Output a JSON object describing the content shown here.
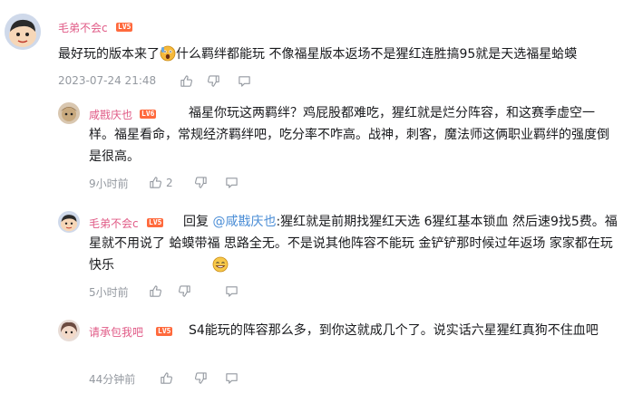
{
  "comments": [
    {
      "user": "毛弟不会c",
      "level": "LV5",
      "text": "最好玩的版本来了",
      "text_after_emoji": "什么羁绊都能玩 不像福星版本返场不是猩红连胜搞95就是天选福星蛤蟆",
      "time": "2023-07-24 21:48"
    },
    {
      "user": "咸戡庆也",
      "level": "LV6",
      "text": "福星你玩这两羁绊？鸡屁股都难吃，猩红就是烂分阵容，和这赛季虚空一样。福星看命，常规经济羁绊吧，吃分率不咋高。战神，刺客，魔法师这俩职业羁绊的强度倒是很高。",
      "time": "9小时前",
      "likes": "2"
    },
    {
      "user": "毛弟不会c",
      "level": "LV5",
      "reply_label": "回复",
      "mention": "@咸戡庆也",
      "text": ":猩红就是前期找猩红天选 6猩红基本锁血 然后速9找5费。福星就不用说了 蛤蟆带福 思路全无。不是说其他阵容不能玩 金铲铲那时候过年返场 家家都在玩快乐",
      "time": "5小时前"
    },
    {
      "user": "请承包我吧",
      "level": "LV5",
      "text": "S4能玩的阵容那么多，到你这就成几个了。说实话六星猩红真狗不住血吧",
      "time": "44分钟前"
    }
  ],
  "icons": [
    "thumb-up-icon",
    "thumb-down-icon",
    "reply-icon"
  ],
  "colors": {
    "username": "#e05a86",
    "level_badge": "#ff6a3d",
    "link": "#4a8dd6",
    "meta": "#9499a0"
  }
}
